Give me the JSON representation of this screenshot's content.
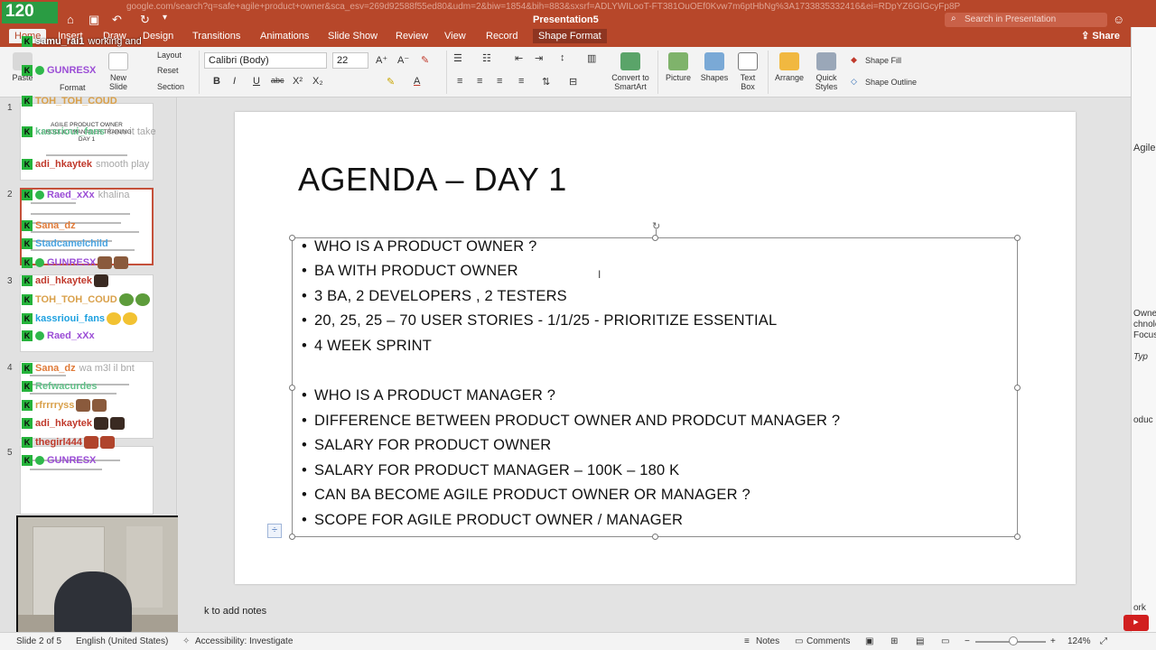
{
  "browser": {
    "url": "google.com/search?q=safe+agile+product+owner&sca_esv=269d92588f55ed80&udm=2&biw=1854&bih=883&sxsrf=ADLYWILooT-FT381OuOEf0Kvw7m6ptHbNg%3A1733835332416&ei=RDpYZ6GIGcyFp8P"
  },
  "stream": {
    "fps": "120"
  },
  "app": {
    "document_title": "Presentation5",
    "search_placeholder": "Search in Presentation",
    "share_label": "Share"
  },
  "tabs": [
    "Home",
    "Insert",
    "Draw",
    "Design",
    "Transitions",
    "Animations",
    "Slide Show",
    "Review",
    "View",
    "Record",
    "Shape Format"
  ],
  "ribbon": {
    "paste": "Paste",
    "format": "Format",
    "new_slide": "New Slide",
    "layout": "Layout",
    "reset": "Reset",
    "section": "Section",
    "font_name": "Calibri (Body)",
    "font_size": "22",
    "convert_smartart": "Convert to SmartArt",
    "picture": "Picture",
    "shapes": "Shapes",
    "text_box": "Text Box",
    "arrange": "Arrange",
    "quick_styles": "Quick Styles",
    "shape_fill": "Shape Fill",
    "shape_outline": "Shape Outline"
  },
  "slides": [
    {
      "num": "1",
      "title": "AGILE PRODUCT OWNER\nPRODUCT MANAGER TRAINING\nDAY 1"
    },
    {
      "num": "2"
    },
    {
      "num": "3"
    },
    {
      "num": "4"
    },
    {
      "num": "5"
    }
  ],
  "chat": [
    {
      "user": "samu_rai1",
      "color": "#ffffff",
      "msg": "working and",
      "badge": false
    },
    {
      "user": "GUNRESX",
      "color": "#9b4dd6",
      "msg": "",
      "badge": true
    },
    {
      "user": "TOH_TOH_COUD",
      "color": "#d9a04a",
      "msg": "",
      "badge": false
    },
    {
      "user": "kassrioui_fans",
      "color": "#63c28a",
      "msg": "how it take",
      "badge": false
    },
    {
      "user": "adi_hkaytek",
      "color": "#c0392b",
      "msg": "smooth play",
      "badge": false
    },
    {
      "user": "Raed_xXx",
      "color": "#9b4dd6",
      "msg": "khalina",
      "badge": true
    },
    {
      "user": "Sana_dz",
      "color": "#e07b39",
      "msg": "",
      "badge": false
    },
    {
      "user": "Stadcamelchild",
      "color": "#4aa3df",
      "msg": "",
      "badge": false
    },
    {
      "user": "GUNRESX",
      "color": "#9b4dd6",
      "msg": "",
      "badge": true
    },
    {
      "user": "adi_hkaytek",
      "color": "#c0392b",
      "msg": "",
      "badge": false
    },
    {
      "user": "TOH_TOH_COUD",
      "color": "#d9a04a",
      "msg": "",
      "badge": false
    },
    {
      "user": "kassrioui_fans",
      "color": "#1ea1e0",
      "msg": "",
      "badge": false
    },
    {
      "user": "Raed_xXx",
      "color": "#9b4dd6",
      "msg": "",
      "badge": true
    },
    {
      "user": "Sana_dz",
      "color": "#e07b39",
      "msg": "wa m3l il bnt",
      "badge": false
    },
    {
      "user": "Refwacurdes",
      "color": "#63c28a",
      "msg": "",
      "badge": false
    },
    {
      "user": "rfrrrryss",
      "color": "#d9a04a",
      "msg": "",
      "badge": false
    },
    {
      "user": "adi_hkaytek",
      "color": "#c0392b",
      "msg": "",
      "badge": false
    },
    {
      "user": "thegirl444",
      "color": "#c0392b",
      "msg": "",
      "badge": false
    },
    {
      "user": "GUNRESX",
      "color": "#9b4dd6",
      "msg": "",
      "badge": true
    }
  ],
  "slide": {
    "title": "AGENDA – DAY 1",
    "bullets": [
      "WHO IS A PRODUCT OWNER ?",
      "BA WITH PRODUCT OWNER",
      "3 BA, 2 DEVELOPERS , 2 TESTERS",
      "20, 25, 25 – 70 USER STORIES - 1/1/25 -  PRIORITIZE  ESSENTIAL",
      "4 WEEK SPRINT",
      "",
      "WHO IS A PRODUCT MANAGER ?",
      "DIFFERENCE BETWEEN PRODUCT OWNER AND PRODCUT  MANAGER ?",
      "SALARY FOR PRODUCT OWNER",
      "SALARY FOR PRODUCT MANAGER – 100K – 180 K",
      "CAN BA BECOME AGILE PRODUCT OWNER OR MANAGER ?",
      "SCOPE FOR AGILE PRODUCT OWNER / MANAGER"
    ]
  },
  "notes_placeholder": "k to add notes",
  "statusbar": {
    "slide_info": "Slide 2 of 5",
    "language": "English (United States)",
    "accessibility": "Accessibility: Investigate",
    "notes": "Notes",
    "comments": "Comments",
    "zoom": "124%"
  },
  "right_pane": {
    "heading": "Agile",
    "lines": [
      "Owner",
      "chnolo",
      "Focus",
      "Typ",
      "oduc",
      "ork"
    ]
  }
}
